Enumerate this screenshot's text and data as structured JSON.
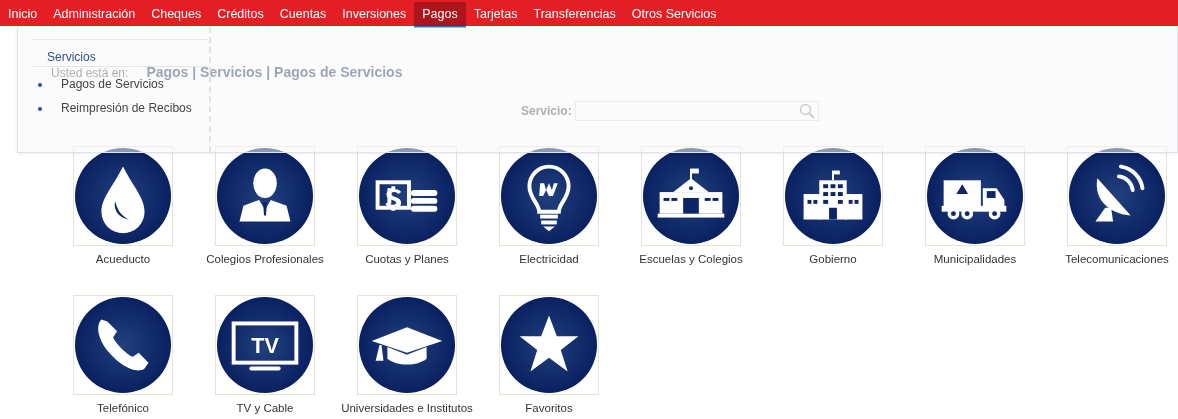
{
  "menu": {
    "items": [
      {
        "label": "Inicio",
        "selected": false
      },
      {
        "label": "Administración",
        "selected": false
      },
      {
        "label": "Cheques",
        "selected": false
      },
      {
        "label": "Créditos",
        "selected": false
      },
      {
        "label": "Cuentas",
        "selected": false
      },
      {
        "label": "Inversiones",
        "selected": false
      },
      {
        "label": "Pagos",
        "selected": true
      },
      {
        "label": "Tarjetas",
        "selected": false
      },
      {
        "label": "Transferencias",
        "selected": false
      },
      {
        "label": "Otros Servicios",
        "selected": false
      }
    ]
  },
  "dropdown": {
    "heading": "Servicios",
    "items": [
      "Pagos de Servicios",
      "Reimpresión de Recibos"
    ]
  },
  "breadcrumb": {
    "label": "Usted está en:",
    "path": "Pagos | Servicios | Pagos de Servicios"
  },
  "search": {
    "label": "Servicio:"
  },
  "services": [
    {
      "label": "Acueducto",
      "kind": "drop"
    },
    {
      "label": "Colegios Profesionales",
      "kind": "person"
    },
    {
      "label": "Cuotas y Planes",
      "kind": "cash"
    },
    {
      "label": "Electricidad",
      "kind": "bulb"
    },
    {
      "label": "Escuelas y Colegios",
      "kind": "school"
    },
    {
      "label": "Gobierno",
      "kind": "building"
    },
    {
      "label": "Municipalidades",
      "kind": "truck"
    },
    {
      "label": "Telecomunicaciones",
      "kind": "dish"
    },
    {
      "label": "Telefónico",
      "kind": "phone"
    },
    {
      "label": "TV y Cable",
      "kind": "tv",
      "icon_text": "TV"
    },
    {
      "label": "Universidades e Institutos",
      "kind": "cap"
    },
    {
      "label": "Favoritos",
      "kind": "star"
    }
  ]
}
